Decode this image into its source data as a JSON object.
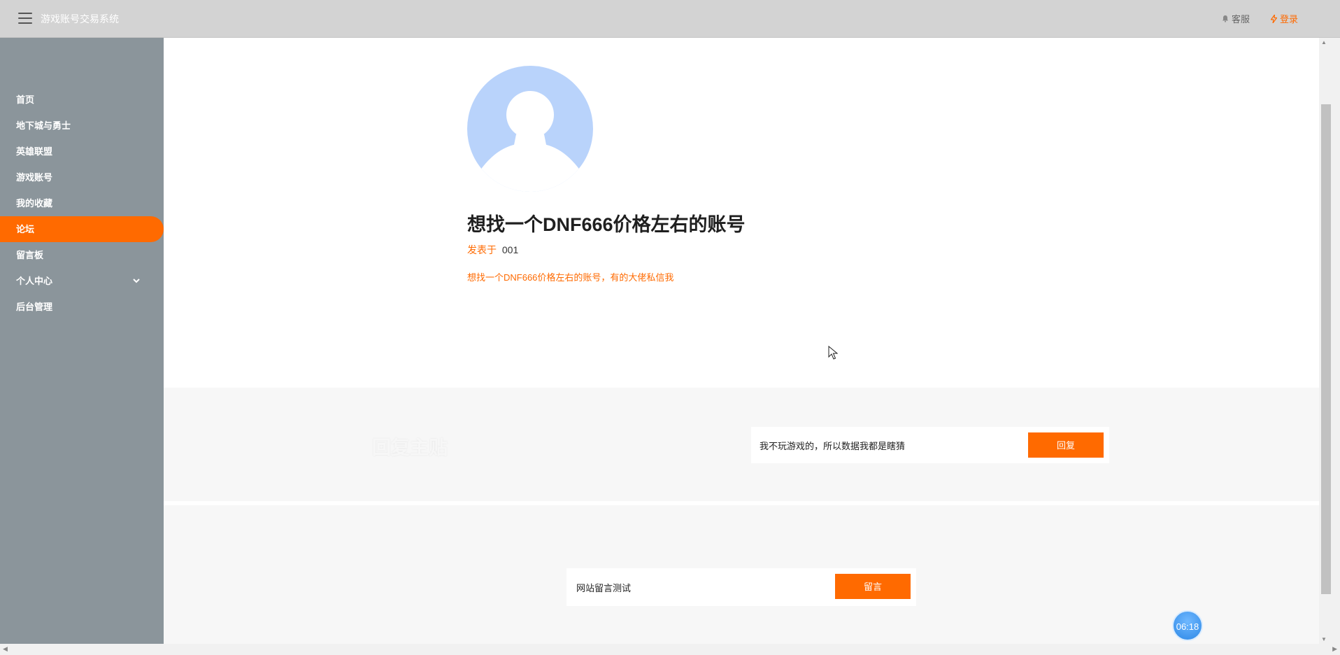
{
  "header": {
    "app_title": "游戏账号交易系统",
    "service_label": "客服",
    "login_label": "登录"
  },
  "sidebar": {
    "items": [
      {
        "label": "首页"
      },
      {
        "label": "地下城与勇士"
      },
      {
        "label": "英雄联盟"
      },
      {
        "label": "游戏账号"
      },
      {
        "label": "我的收藏"
      },
      {
        "label": "论坛",
        "active": true
      },
      {
        "label": "留言板"
      },
      {
        "label": "个人中心",
        "expandable": true
      },
      {
        "label": "后台管理"
      }
    ]
  },
  "post": {
    "title": "想找一个DNF666价格左右的账号",
    "posted_by_label": "发表于",
    "author": "001",
    "body": "想找一个DNF666价格左右的账号，有的大佬私信我"
  },
  "reply": {
    "heading": "回复主贴",
    "input_value": "我不玩游戏的，所以数据我都是瞎猜",
    "button_label": "回复"
  },
  "message": {
    "input_value": "网站留言测试",
    "button_label": "留言"
  },
  "clock": {
    "time": "06:18"
  },
  "colors": {
    "accent": "#ff6a00",
    "sidebar_bg": "#8b959b",
    "topbar_bg": "#d3d3d3",
    "avatar_bg": "#b9d3fb"
  }
}
